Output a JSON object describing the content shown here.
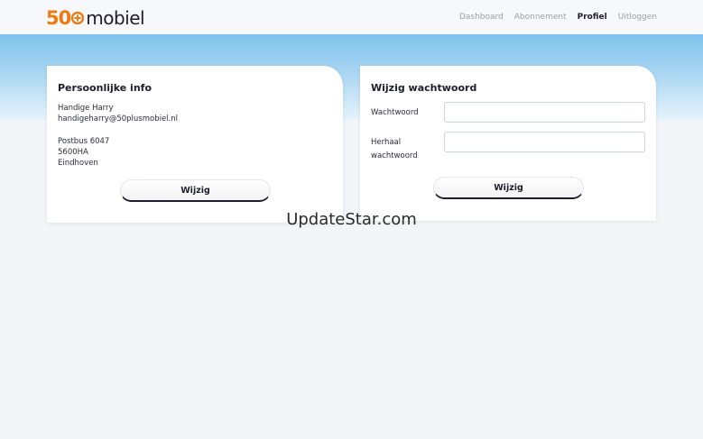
{
  "brand": {
    "logo_number": "50",
    "logo_text": "mobiel",
    "accent_color": "#f07a12",
    "logo_icon": "plus-icon"
  },
  "nav": {
    "items": [
      {
        "label": "Dashboard",
        "active": false
      },
      {
        "label": "Abonnement",
        "active": false
      },
      {
        "label": "Profiel",
        "active": true
      },
      {
        "label": "Uitloggen",
        "active": false
      }
    ]
  },
  "personal_info": {
    "title": "Persoonlijke info",
    "name": "Handige Harry",
    "email": "handigeharry@50plusmobiel.nl",
    "address_line1": "Postbus 6047",
    "postal_code": "5600HA",
    "city": "Eindhoven",
    "button_label": "Wijzig"
  },
  "password": {
    "title": "Wijzig wachtwoord",
    "password_label": "Wachtwoord",
    "password_value": "",
    "repeat_label_line1": "Herhaal",
    "repeat_label_line2": "wachtwoord",
    "repeat_value": "",
    "button_label": "Wijzig"
  },
  "watermark": "UpdateStar.com"
}
